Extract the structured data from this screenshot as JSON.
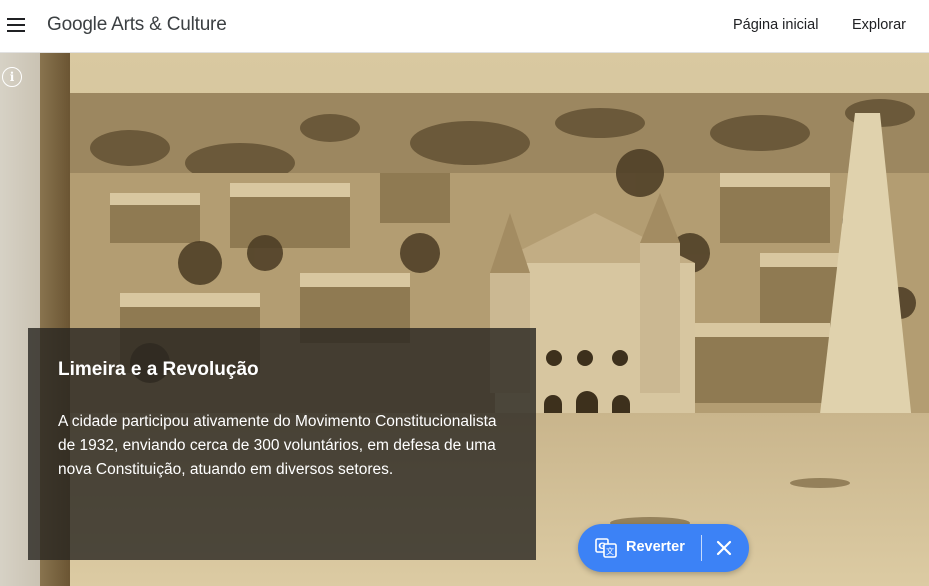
{
  "header": {
    "logo_text": "Google Arts & Culture",
    "nav": {
      "home": "Página inicial",
      "explore": "Explorar"
    }
  },
  "hero": {
    "image_description_icon": "info-icon"
  },
  "caption": {
    "title": "Limeira e a Revolução",
    "body": "A cidade participou ativamente do Movimento Constitucionalista de 1932, enviando cerca de 300 voluntários, em defesa de uma nova Constituição, atuando em diversos setores."
  },
  "translate_bar": {
    "revert_label": "Reverter",
    "accent_color": "#3c82f6"
  },
  "icons": {
    "menu": "hamburger-menu-icon",
    "info": "info-icon",
    "translate": "translate-icon",
    "close": "close-icon"
  }
}
